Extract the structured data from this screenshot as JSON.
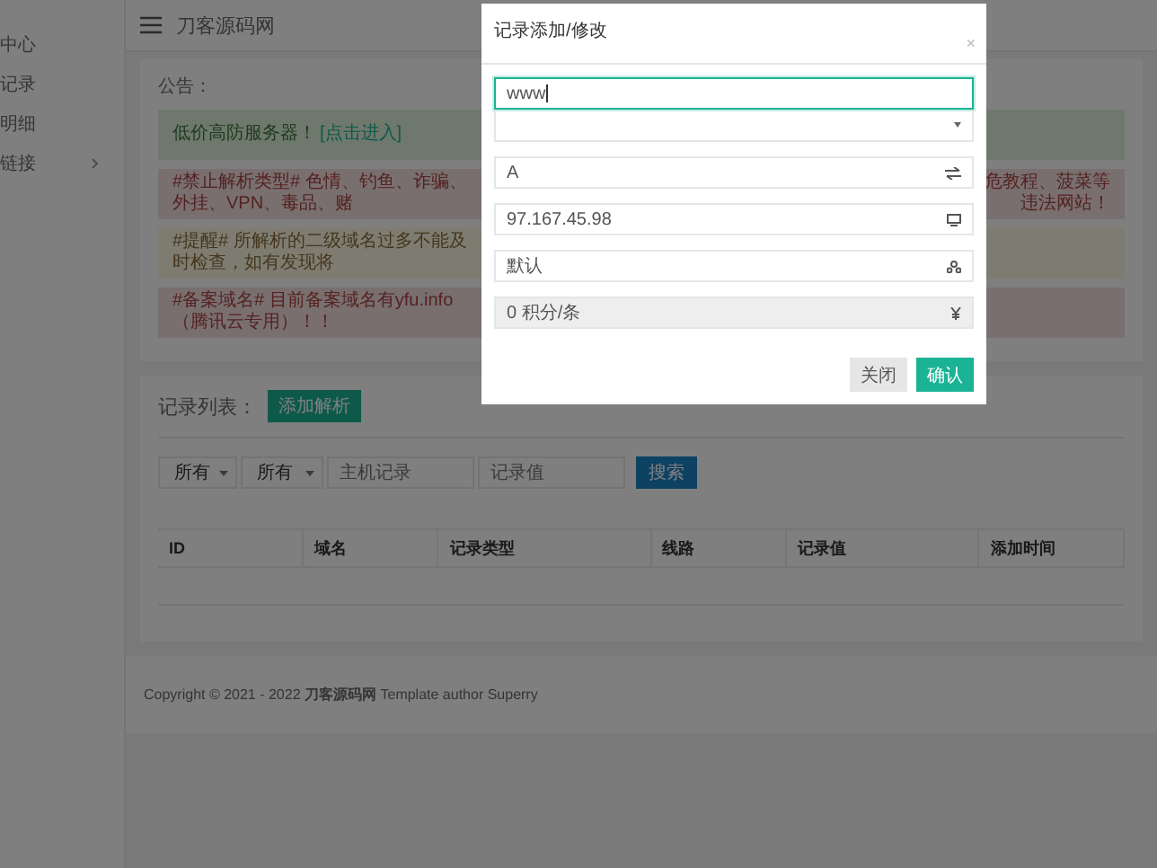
{
  "sidebar": {
    "items": [
      {
        "label": "中心",
        "has_arrow": false
      },
      {
        "label": "记录",
        "has_arrow": false
      },
      {
        "label": "明细",
        "has_arrow": false
      },
      {
        "label": "链接",
        "has_arrow": true
      }
    ]
  },
  "header": {
    "title": "刀客源码网"
  },
  "notice_card": {
    "title": "公告：",
    "notices": [
      {
        "kind": "success",
        "text": "低价高防服务器！",
        "link": "[点击进入]"
      },
      {
        "kind": "danger",
        "text": "#禁止解析类型# 色情、钓鱼、诈骗、外挂、VPN、毒品、赌",
        "tail": "危教程、菠菜等违法网站！"
      },
      {
        "kind": "warning",
        "text": "#提醒# 所解析的二级域名过多不能及时检查，如有发现将"
      },
      {
        "kind": "danger",
        "text": "#备案域名# 目前备案域名有yfu.info（腾讯云专用）！！"
      }
    ]
  },
  "records": {
    "title": "记录列表：",
    "add_button": "添加解析",
    "filters": [
      {
        "kind": "select",
        "value": "所有"
      },
      {
        "kind": "select",
        "value": "所有"
      },
      {
        "kind": "input",
        "placeholder": "主机记录"
      },
      {
        "kind": "input",
        "placeholder": "记录值"
      }
    ],
    "search_button": "搜索",
    "columns": [
      "ID",
      "域名",
      "记录类型",
      "线路",
      "记录值",
      "添加时间"
    ]
  },
  "footer": {
    "text": "Copyright © 2021 - 2022 **刀客源码网** Template author Superry"
  },
  "modal": {
    "title": "记录添加/修改",
    "close": "×",
    "fields": [
      {
        "kind": "input",
        "value": "www",
        "focused": true
      },
      {
        "kind": "select",
        "focused": false
      },
      {
        "kind": "input",
        "value": "A",
        "focused": false
      },
      {
        "kind": "input",
        "value": "97.167.45.98",
        "focused": false
      },
      {
        "kind": "input",
        "value": "默认",
        "focused": false
      },
      {
        "kind": "disabled",
        "value": "0 积分/条",
        "focused": false
      }
    ],
    "buttons": [
      {
        "label": "关闭",
        "kind": "default"
      },
      {
        "label": "确认",
        "kind": "primary"
      }
    ]
  }
}
